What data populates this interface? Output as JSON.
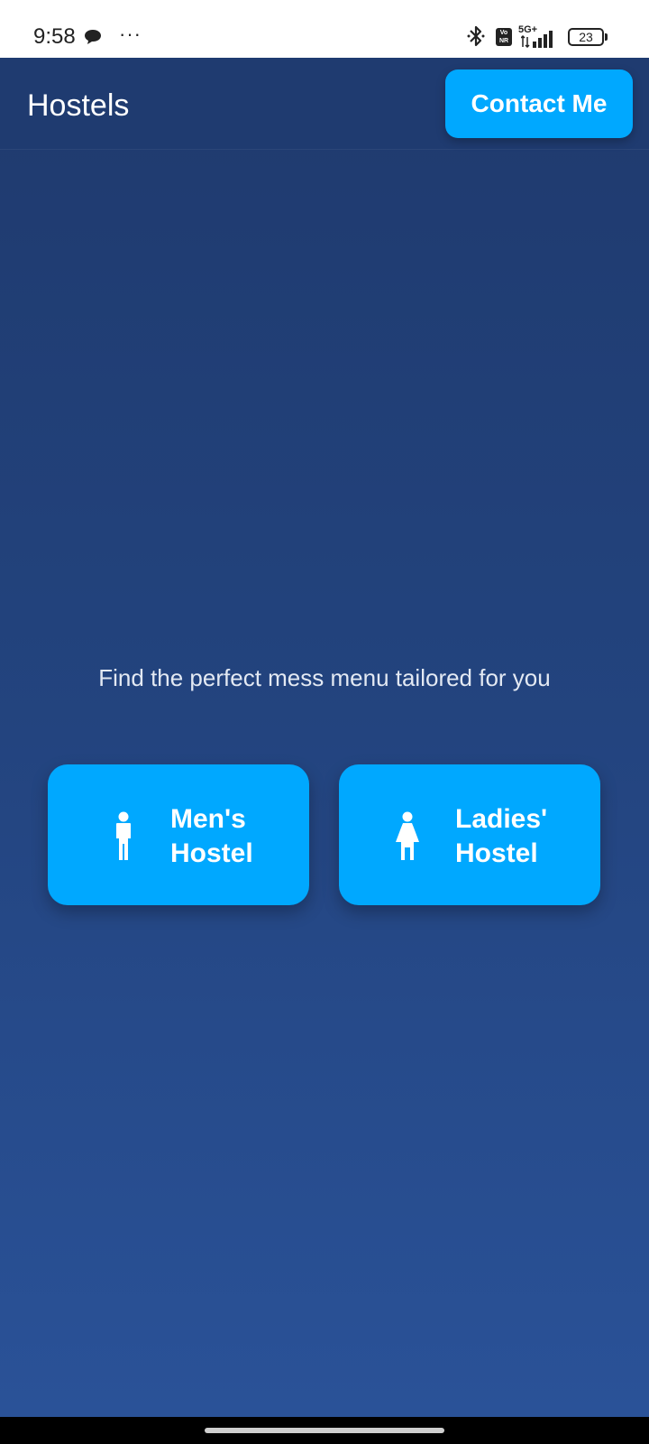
{
  "status_bar": {
    "time": "9:58",
    "more": "···",
    "network": "5G+",
    "volte_top": "Vo",
    "volte_bottom": "NR",
    "battery": "23"
  },
  "header": {
    "title": "Hostels",
    "contact_label": "Contact Me"
  },
  "main": {
    "tagline": "Find the perfect mess menu tailored for you",
    "cards": [
      {
        "line1": "Men's",
        "line2": "Hostel",
        "icon": "male-icon"
      },
      {
        "line1": "Ladies'",
        "line2": "Hostel",
        "icon": "female-icon"
      }
    ]
  },
  "colors": {
    "accent": "#00a8ff",
    "header_bg": "#1f3b70",
    "bg_top": "#1f3a6e",
    "bg_bottom": "#2a5298"
  }
}
